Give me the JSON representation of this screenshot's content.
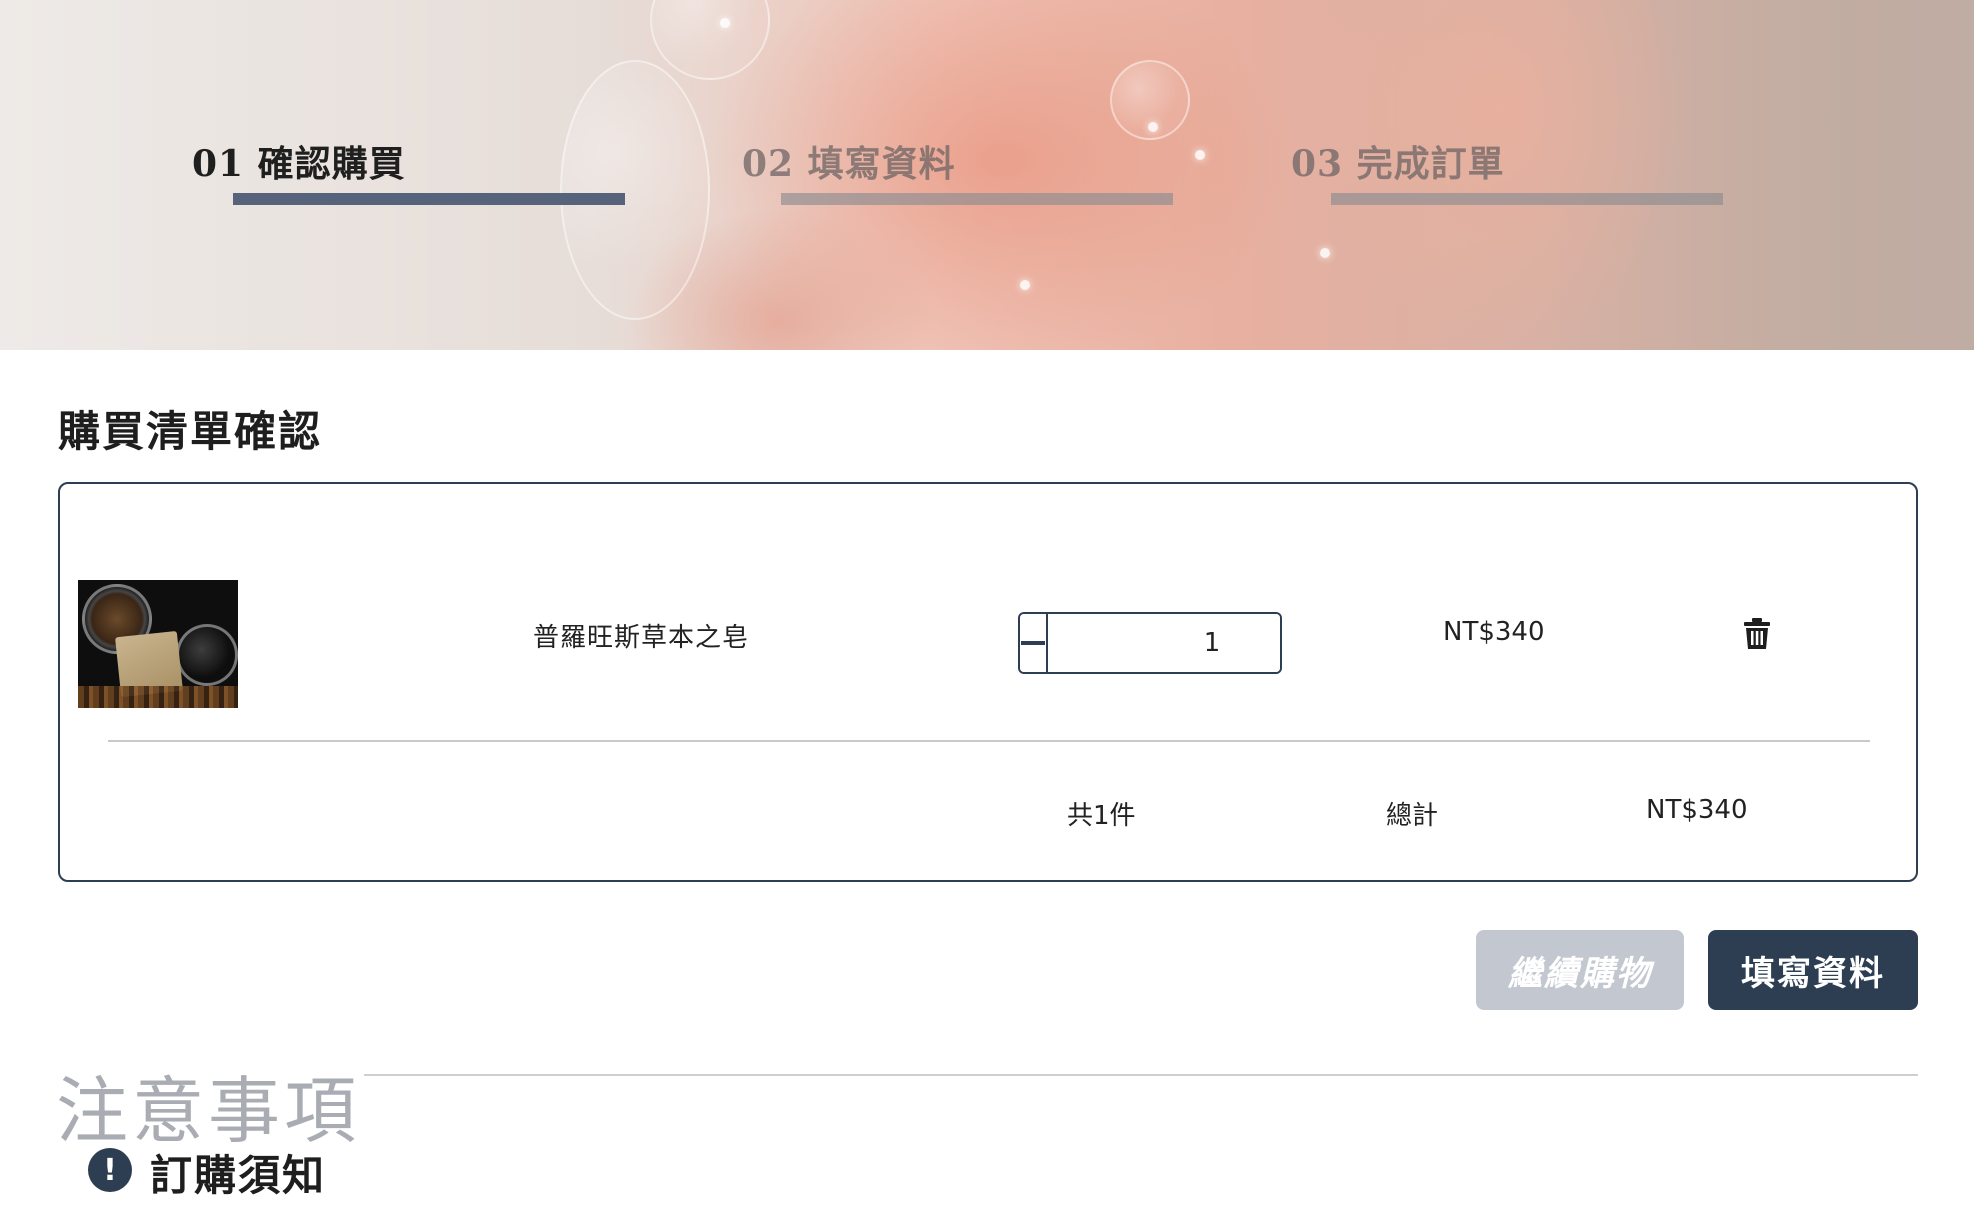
{
  "steps": [
    {
      "label": "01 確認購買",
      "state": "active"
    },
    {
      "label": "02 填寫資料",
      "state": "inactive"
    },
    {
      "label": "03 完成訂單",
      "state": "inactive"
    }
  ],
  "cart": {
    "title": "購買清單確認",
    "item": {
      "name": "普羅旺斯草本之皂",
      "quantity": "1",
      "price": "NT$340",
      "minus_icon": "minus-icon",
      "plus_icon": "plus-icon",
      "delete_icon": "trash-icon"
    },
    "summary": {
      "count": "共1件",
      "total_label": "總計",
      "total": "NT$340"
    }
  },
  "actions": {
    "continue_label": "繼續購物",
    "next_label": "填寫資料"
  },
  "notice": {
    "title": "注意事項",
    "subtitle": "訂購須知",
    "subtitle_icon": "exclamation-circle-icon"
  },
  "colors": {
    "primary": "#2d3e52",
    "disabled": "#c3c8d0",
    "active_step_bar": "#56637a"
  }
}
